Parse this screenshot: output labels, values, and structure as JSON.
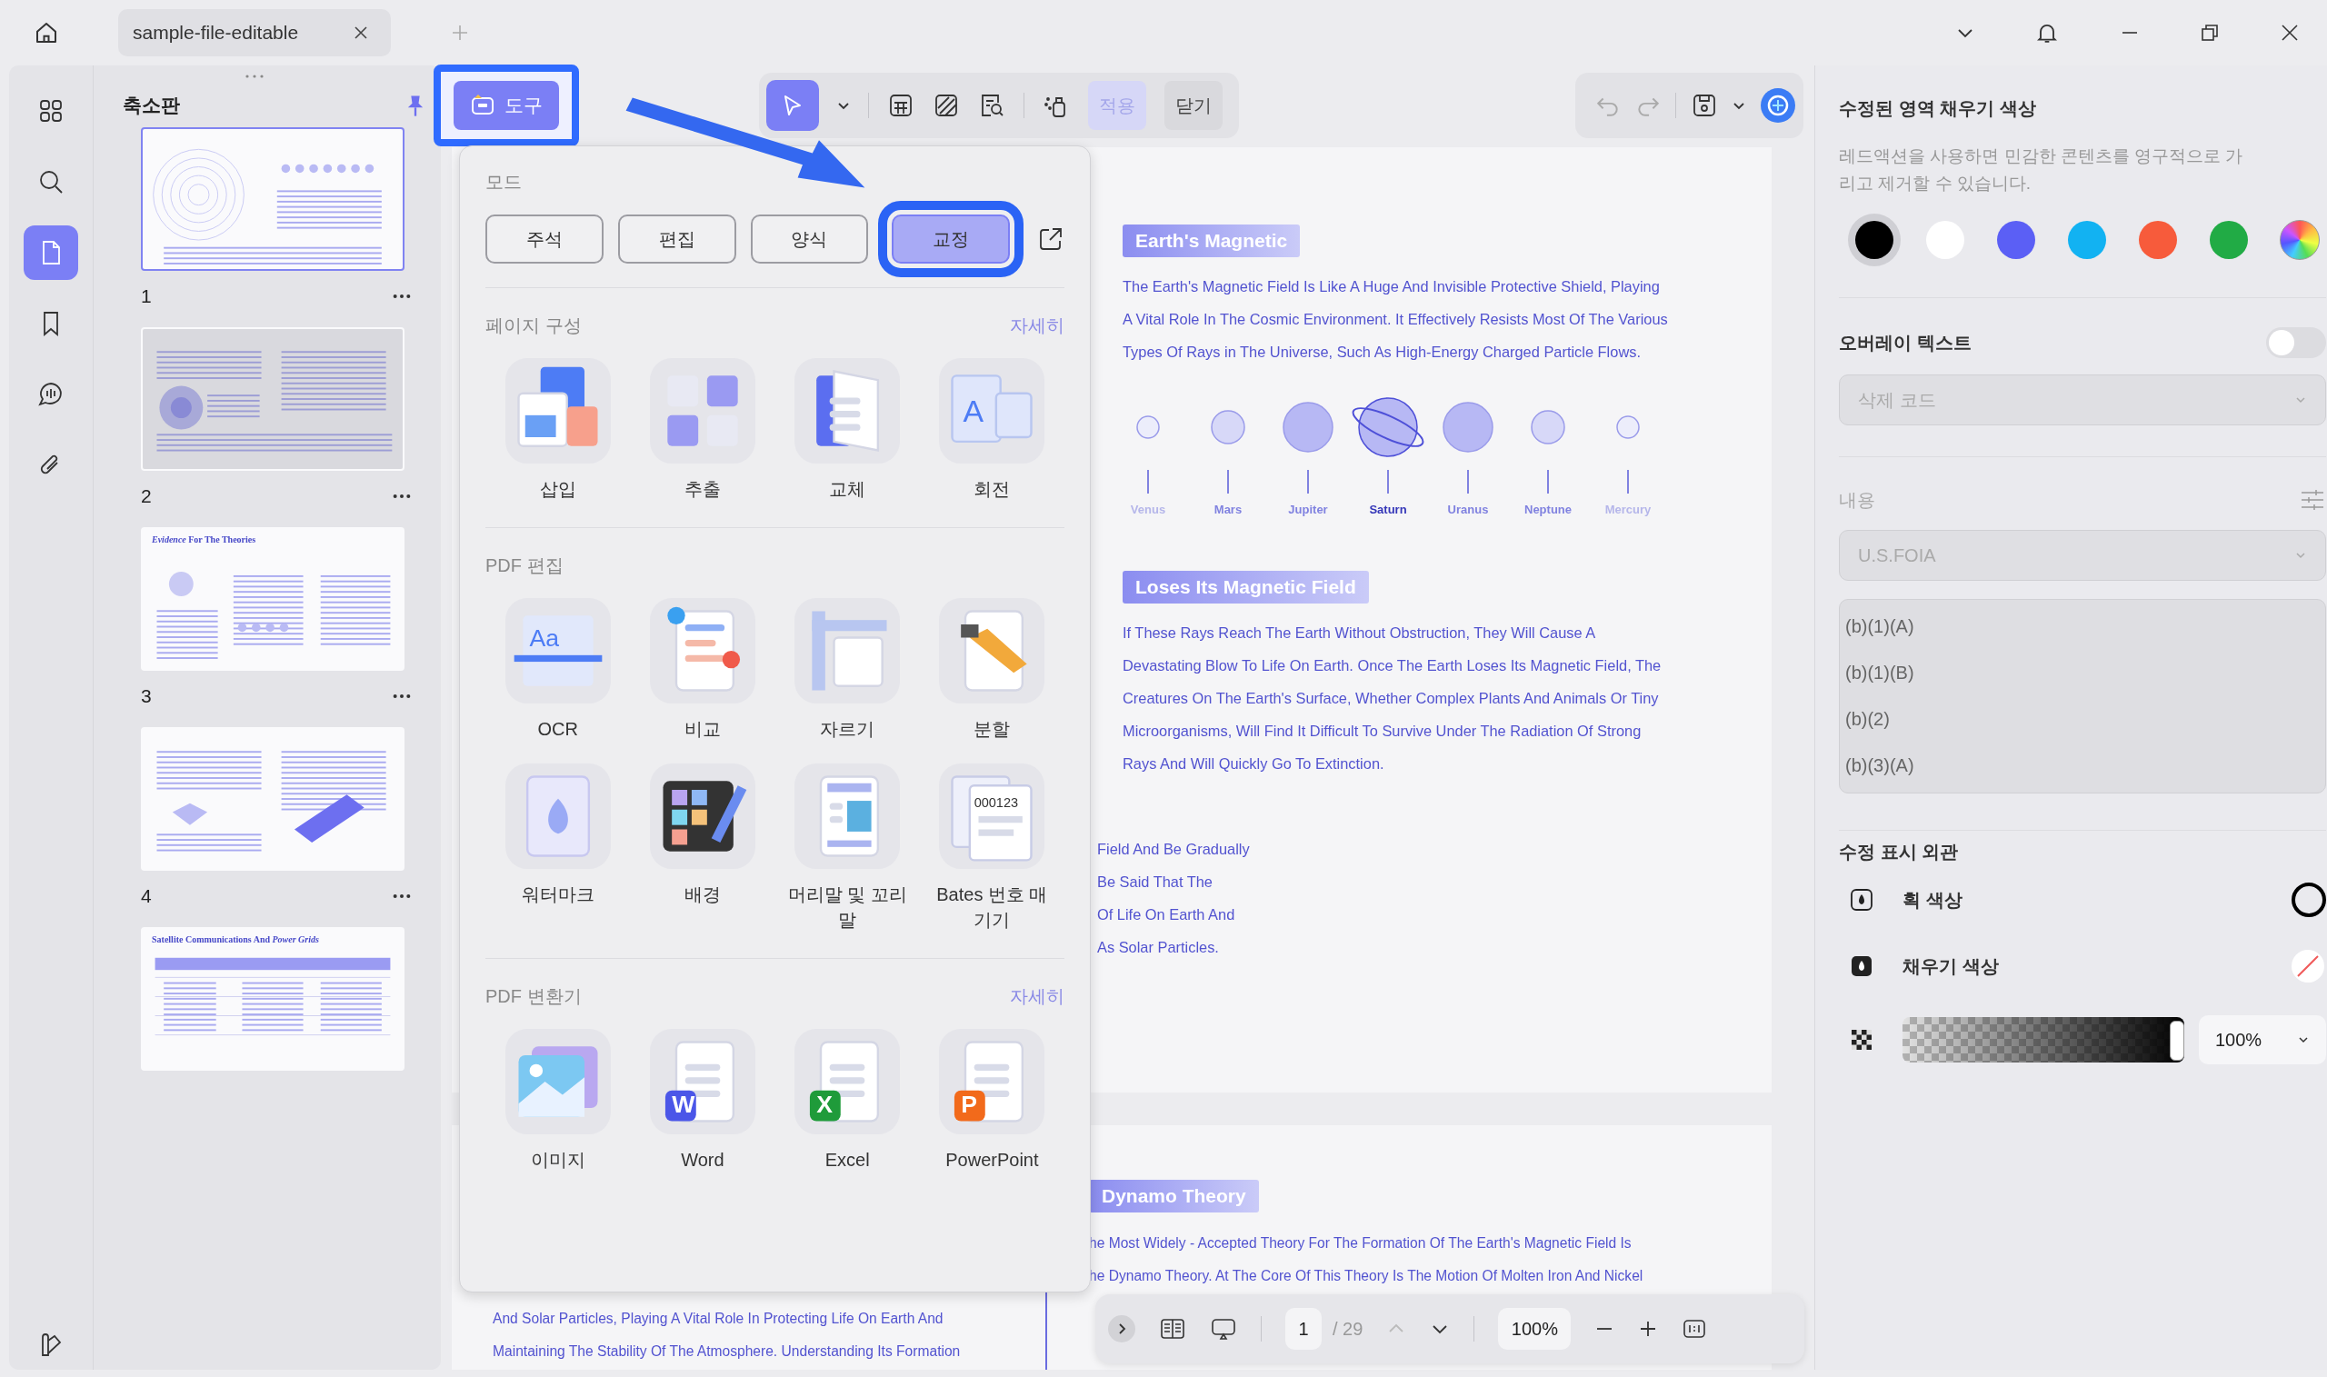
{
  "title_bar": {
    "tab": {
      "label": "sample-file-editable",
      "selected": true
    }
  },
  "rail": {
    "items": [
      {
        "kind": "grid",
        "selected": false
      },
      {
        "kind": "search",
        "selected": false
      },
      {
        "kind": "pages",
        "selected": true
      },
      {
        "kind": "bookmark",
        "selected": false
      },
      {
        "kind": "comment",
        "selected": false
      },
      {
        "kind": "attachment",
        "selected": false
      }
    ]
  },
  "thumbnails": {
    "title": "축소판",
    "pages": [
      {
        "number": "1",
        "selected": true,
        "in_view": false,
        "kind": "planets"
      },
      {
        "number": "2",
        "selected": false,
        "in_view": true,
        "kind": "sphere"
      },
      {
        "number": "3",
        "selected": false,
        "in_view": false,
        "kind": "evidence",
        "title": "*Evidence* For The Theories"
      },
      {
        "number": "4",
        "selected": false,
        "in_view": false,
        "kind": "satellite"
      },
      {
        "selected": false,
        "in_view": false,
        "kind": "table",
        "title": "Satellite Communications And *Power Grids*"
      }
    ]
  },
  "toolbar": {
    "tools_button": {
      "label": "도구",
      "highlighted": true
    },
    "apply": {
      "label": "적용",
      "disabled": true
    },
    "close": {
      "label": "닫기"
    }
  },
  "tools_menu": {
    "mode_title": "모드",
    "modes": [
      {
        "label": "주석",
        "selected": false
      },
      {
        "label": "편집",
        "selected": false
      },
      {
        "label": "양식",
        "selected": false
      },
      {
        "label": "교정",
        "selected": true
      }
    ],
    "sections": [
      {
        "title": "페이지 구성",
        "more": "자세히",
        "items": [
          {
            "label": "삽입",
            "kind": "insert"
          },
          {
            "label": "추출",
            "kind": "extract"
          },
          {
            "label": "교체",
            "kind": "replace"
          },
          {
            "label": "회전",
            "kind": "rotate",
            "icon_text": "A"
          }
        ]
      },
      {
        "title": "PDF 편집",
        "items": [
          {
            "label": "OCR",
            "kind": "ocr",
            "icon_text": "Aa"
          },
          {
            "label": "비교",
            "kind": "compare"
          },
          {
            "label": "자르기",
            "kind": "crop"
          },
          {
            "label": "분할",
            "kind": "split"
          },
          {
            "label": "워터마크",
            "kind": "watermark"
          },
          {
            "label": "배경",
            "kind": "background"
          },
          {
            "label": "머리말 및 꼬리말",
            "kind": "header-footer"
          },
          {
            "label": "Bates 번호 매기기",
            "kind": "bates",
            "icon_text": "000123"
          }
        ]
      },
      {
        "title": "PDF 변환기",
        "more": "자세히",
        "items": [
          {
            "label": "이미지",
            "kind": "image"
          },
          {
            "label": "Word",
            "kind": "word",
            "icon_text": "W"
          },
          {
            "label": "Excel",
            "kind": "excel",
            "icon_text": "X"
          },
          {
            "label": "PowerPoint",
            "kind": "powerpoint",
            "icon_text": "P"
          }
        ]
      }
    ]
  },
  "document": {
    "page_1": {
      "heading": "Earth's Magnetic",
      "paragraph": "The Earth's Magnetic Field Is Like A Huge And Invisible Protective Shield, Playing A Vital Role In The Cosmic Environment. It Effectively Resists Most Of The Various Types Of Rays in The Universe, Such As High-Energy Charged Particle Flows.",
      "planets": [
        {
          "name": "Venus",
          "kind": "small"
        },
        {
          "name": "Mars",
          "kind": "medium"
        },
        {
          "name": "Jupiter",
          "kind": "large"
        },
        {
          "name": "Saturn",
          "kind": "ringed"
        },
        {
          "name": "Uranus",
          "kind": "large"
        },
        {
          "name": "Neptune",
          "kind": "medium"
        },
        {
          "name": "Mercury",
          "kind": "small"
        }
      ],
      "heading_2": "Loses Its Magnetic Field",
      "paragraph_2": "If These Rays Reach The Earth Without Obstruction, They Will Cause A Devastating Blow To Life On Earth. Once The Earth Loses Its Magnetic Field, The Creatures On The Earth's Surface, Whether Complex Plants And Animals Or Tiny Microorganisms, Will Find It Difficult To Survive Under The Radiation Of Strong Rays And Will Quickly Go To Extinction.",
      "cut_lines": [
        "Field And Be Gradually",
        "Be Said That The",
        "Of Life On Earth And",
        "As Solar Particles."
      ]
    },
    "page_2": {
      "left_lines": [
        "And Solar Particles, Playing A Vital Role In Protecting Life On Earth And",
        "Maintaining The Stability Of The Atmosphere. Understanding Its Formation"
      ],
      "heading": "Dynamo Theory",
      "lines": [
        "he Most Widely - Accepted Theory For The Formation Of The Earth's Magnetic Field Is",
        "he Dynamo Theory. At The Core Of This Theory Is The Motion Of Molten Iron And Nickel"
      ]
    }
  },
  "page_nav": {
    "page": "1",
    "total": "/ 29",
    "zoom": "100%"
  },
  "redaction_panel": {
    "title": "수정된 영역 채우기 색상",
    "description": "레드액션을 사용하면 민감한 콘텐츠를 영구적으로 가리고 제거할 수 있습니다.",
    "swatches": [
      {
        "kind": "solid",
        "color": "#000000",
        "selected": true
      },
      {
        "kind": "solid",
        "color": "#ffffff",
        "selected": false
      },
      {
        "kind": "solid",
        "color": "#5b5ff5",
        "selected": false
      },
      {
        "kind": "solid",
        "color": "#12b2f2",
        "selected": false
      },
      {
        "kind": "solid",
        "color": "#f75b3b",
        "selected": false
      },
      {
        "kind": "solid",
        "color": "#21ab45",
        "selected": false
      },
      {
        "kind": "spectrum",
        "selected": false
      }
    ],
    "overlay_text": {
      "label": "오버레이 텍스트",
      "on": false
    },
    "code_select": {
      "placeholder": "삭제 코드",
      "disabled": true
    },
    "content_label": "내용",
    "content_select": {
      "value": "U.S.FOIA",
      "disabled": true
    },
    "codes": [
      {
        "label": "(b)(1)(A)",
        "selected": false
      },
      {
        "label": "(b)(1)(B)",
        "selected": false
      },
      {
        "label": "(b)(2)",
        "selected": false
      },
      {
        "label": "(b)(3)(A)",
        "selected": false
      }
    ],
    "appearance_title": "수정 표시 외관",
    "stroke": {
      "label": "획 색상",
      "color": "#000000"
    },
    "fill": {
      "label": "채우기 색상",
      "none": true
    },
    "opacity": {
      "level": 1.0,
      "value": "100%"
    }
  }
}
